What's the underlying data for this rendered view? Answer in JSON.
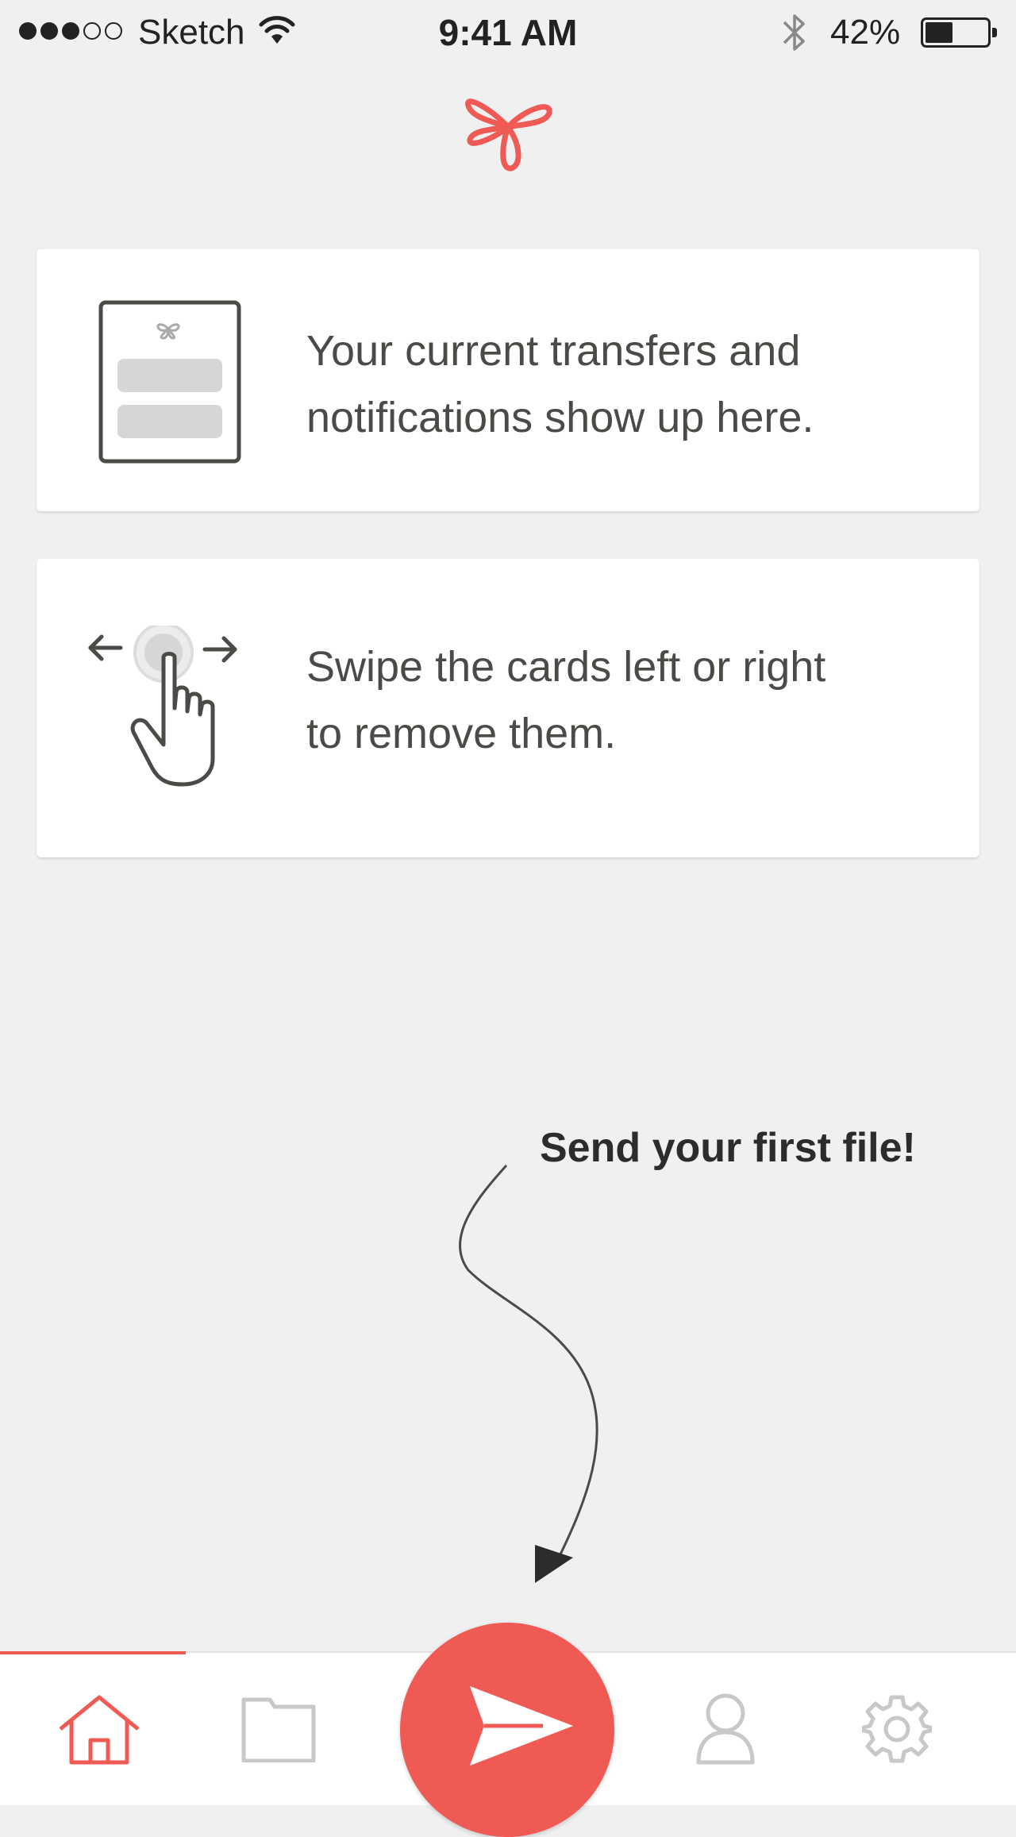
{
  "status_bar": {
    "carrier": "Sketch",
    "time": "9:41 AM",
    "battery_percent": "42%",
    "battery_level": 0.42
  },
  "brand": {
    "logo_icon": "cloverleaf-logo-icon",
    "accent_color": "#f05a55"
  },
  "cards": [
    {
      "icon": "notification-card-icon",
      "text_line1": "Your current transfers and",
      "text_line2": "notifications show up here."
    },
    {
      "icon": "swipe-gesture-icon",
      "text_line1": "Swipe the cards left or right",
      "text_line2": "to remove them."
    }
  ],
  "callout": {
    "text": "Send your first file!"
  },
  "tab_bar": {
    "tabs": [
      {
        "name": "home",
        "icon": "home-icon",
        "active": true
      },
      {
        "name": "files",
        "icon": "folder-icon",
        "active": false
      },
      {
        "name": "send",
        "icon": "send-icon",
        "active": false
      },
      {
        "name": "profile",
        "icon": "person-icon",
        "active": false
      },
      {
        "name": "settings",
        "icon": "gear-icon",
        "active": false
      }
    ]
  }
}
